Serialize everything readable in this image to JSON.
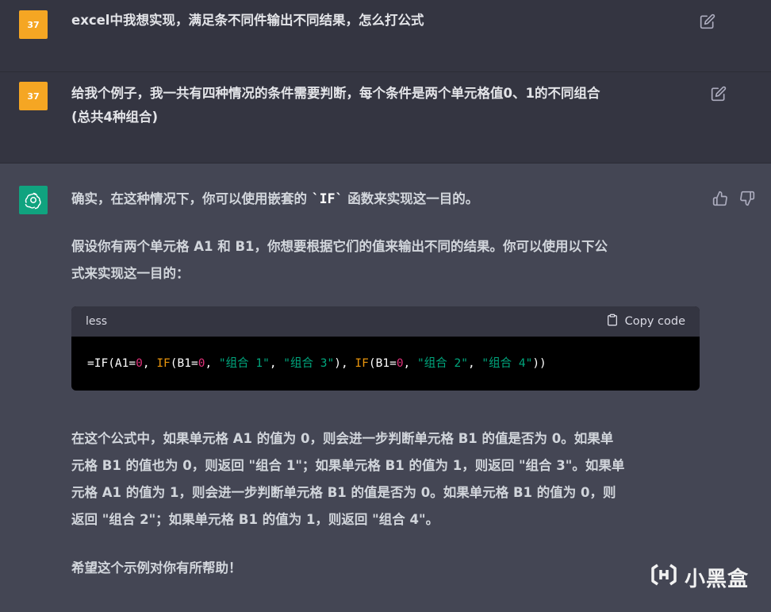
{
  "messages": [
    {
      "role": "user",
      "avatar_label": "37",
      "text": "excel中我想实现，满足条不同件输出不同结果，怎么打公式"
    },
    {
      "role": "user",
      "avatar_label": "37",
      "text_line1": "给我个例子，我一共有四种情况的条件需要判断，每个条件是两个单元格值0、1的不同组合",
      "text_line2": "(总共4种组合)"
    }
  ],
  "assistant": {
    "intro_before": "确实，在这种情况下，你可以使用嵌套的 ",
    "intro_code": "`IF`",
    "intro_after": " 函数来实现这一目的。",
    "para2_line1": "假设你有两个单元格 A1 和 B1，你想要根据它们的值来输出不同的结果。你可以使用以下公",
    "para2_line2": "式来实现这一目的：",
    "code_block": {
      "language": "less",
      "copy_label": "Copy code",
      "tokens": [
        {
          "t": "=IF(A1=",
          "c": "plain"
        },
        {
          "t": "0",
          "c": "num"
        },
        {
          "t": ", ",
          "c": "plain"
        },
        {
          "t": "IF",
          "c": "fn"
        },
        {
          "t": "(B1=",
          "c": "plain"
        },
        {
          "t": "0",
          "c": "num"
        },
        {
          "t": ", ",
          "c": "plain"
        },
        {
          "t": "\"组合 1\"",
          "c": "str"
        },
        {
          "t": ", ",
          "c": "plain"
        },
        {
          "t": "\"组合 3\"",
          "c": "str"
        },
        {
          "t": "), ",
          "c": "plain"
        },
        {
          "t": "IF",
          "c": "fn"
        },
        {
          "t": "(B1=",
          "c": "plain"
        },
        {
          "t": "0",
          "c": "num"
        },
        {
          "t": ", ",
          "c": "plain"
        },
        {
          "t": "\"组合 2\"",
          "c": "str"
        },
        {
          "t": ", ",
          "c": "plain"
        },
        {
          "t": "\"组合 4\"",
          "c": "str"
        },
        {
          "t": "))",
          "c": "plain"
        }
      ]
    },
    "para3_lines": [
      "在这个公式中，如果单元格 A1 的值为 0，则会进一步判断单元格 B1 的值是否为 0。如果单",
      "元格 B1 的值也为 0，则返回 \"组合 1\"；如果单元格 B1 的值为 1，则返回 \"组合 3\"。如果单",
      "元格 A1 的值为 1，则会进一步判断单元格 B1 的值是否为 0。如果单元格 B1 的值为 0，则",
      "返回 \"组合 2\"；如果单元格 B1 的值为 1，则返回 \"组合 4\"。"
    ],
    "closing": "希望这个示例对你有所帮助！"
  },
  "watermark": {
    "text": "小黑盒"
  },
  "colors": {
    "user_bg": "#343541",
    "assistant_bg": "#444654",
    "user_avatar": "#f5a623",
    "bot_avatar": "#10a37f",
    "code_fn": "#e9950c",
    "code_num": "#df3079",
    "code_str": "#00a67d"
  },
  "icons": [
    "edit-icon",
    "openai-logo-icon",
    "thumbs-up-icon",
    "thumbs-down-icon",
    "clipboard-icon",
    "xiaoheihe-logo-icon"
  ]
}
